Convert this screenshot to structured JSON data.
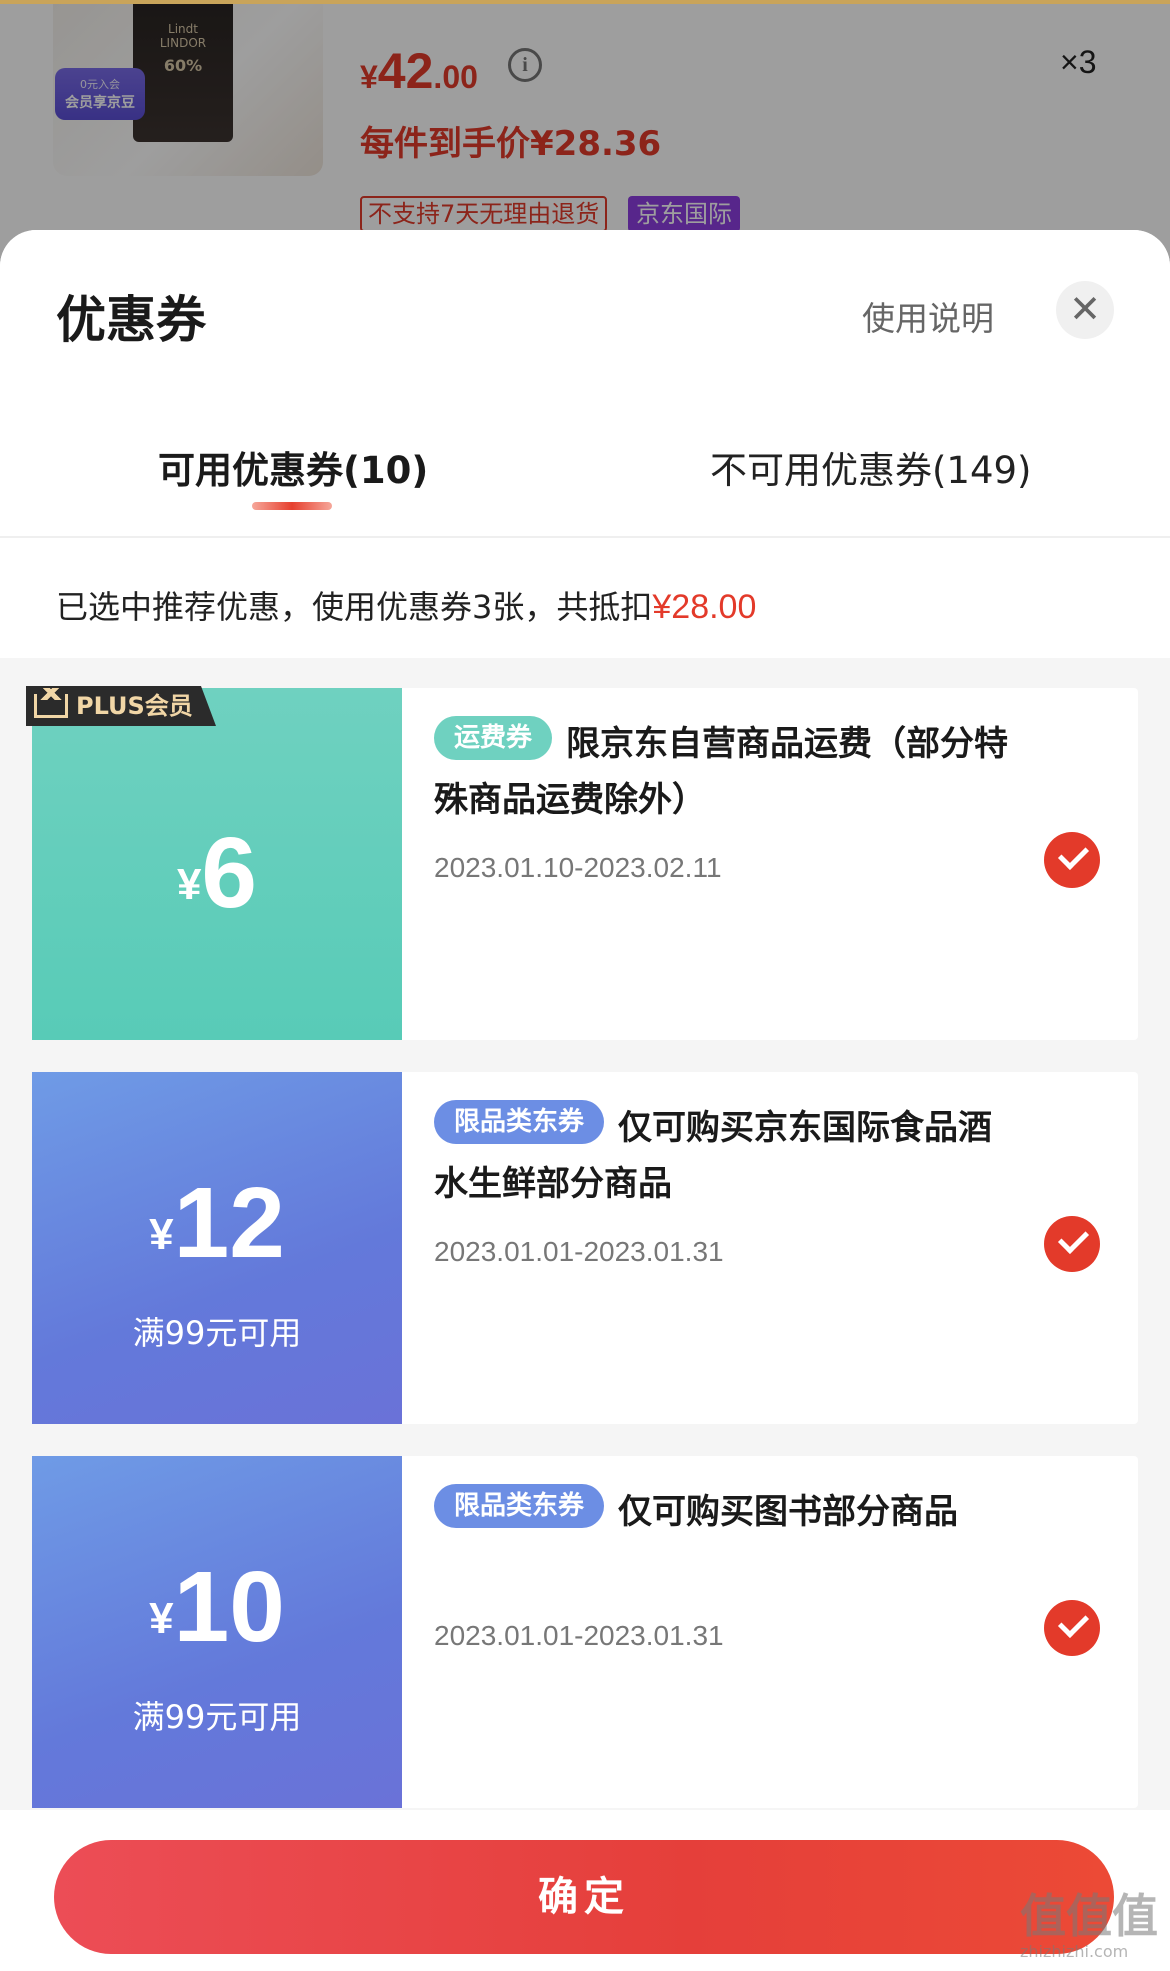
{
  "product": {
    "box_brand": "Lindt",
    "box_name": "LINDOR",
    "box_cocoa": "60%",
    "badge_line1": "0元入会",
    "badge_line2": "会员享京豆",
    "price_currency": "¥",
    "price_integer": "42",
    "price_decimal": ".00",
    "info_icon": "i",
    "price_after_label": "每件到手价¥28.36",
    "quantity": "×3",
    "tag_return": "不支持7天无理由退货",
    "tag_intl": "京东国际"
  },
  "sheet": {
    "title": "优惠券",
    "usage_link": "使用说明",
    "close_icon": "✕",
    "tabs": [
      {
        "label": "可用优惠券(10)",
        "active": true
      },
      {
        "label": "不可用优惠券(149)",
        "active": false
      }
    ],
    "summary_text": "已选中推荐优惠，使用优惠券3张，共抵扣",
    "summary_amount": "¥28.00"
  },
  "coupons": [
    {
      "badge": "PLUS会员",
      "currency": "¥",
      "amount": "6",
      "condition": "",
      "type_label": "运费券",
      "desc_line1": "限京东自营商品运费（部分特",
      "desc_line2": "殊商品运费除外）",
      "date": "2023.01.10-2023.02.11",
      "selected": true,
      "color": "#5fcdb9"
    },
    {
      "badge": "",
      "currency": "¥",
      "amount": "12",
      "condition": "满99元可用",
      "type_label": "限品类东券",
      "desc_line1": "仅可购买京东国际食品酒",
      "desc_line2": "水生鲜部分商品",
      "date": "2023.01.01-2023.01.31",
      "selected": true,
      "color": "#6a7fdc"
    },
    {
      "badge": "",
      "currency": "¥",
      "amount": "10",
      "condition": "满99元可用",
      "type_label": "限品类东券",
      "desc_line1": "仅可购买图书部分商品",
      "desc_line2": "",
      "date": "2023.01.01-2023.01.31",
      "selected": true,
      "color": "#6a7fdc"
    }
  ],
  "footer": {
    "confirm_label": "确定"
  },
  "watermark": {
    "text": "值值值",
    "domain": "zhizhizhi.com"
  },
  "colors": {
    "accent_red": "#e33a2a",
    "teal": "#5fcdb9",
    "blue": "#6a7fdc"
  }
}
